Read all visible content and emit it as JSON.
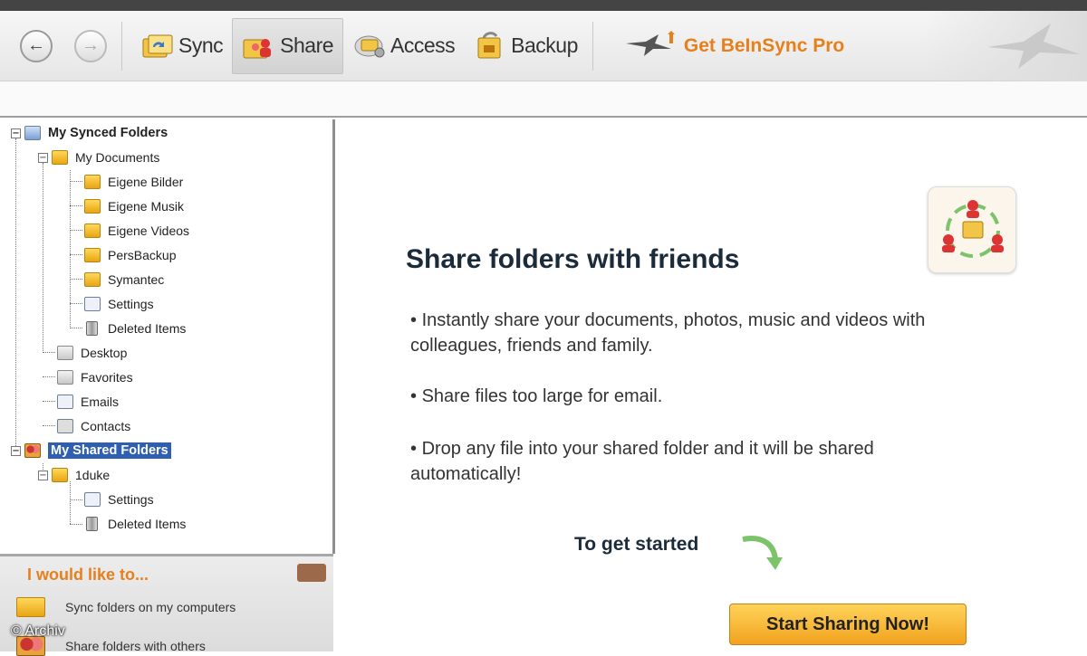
{
  "toolbar": {
    "back_icon": "back-arrow-icon",
    "forward_icon": "forward-arrow-icon",
    "sync_label": "Sync",
    "share_label": "Share",
    "access_label": "Access",
    "backup_label": "Backup",
    "pro_label": "Get BeInSync Pro"
  },
  "tree": {
    "synced_root": "My Synced Folders",
    "my_documents": "My Documents",
    "eigene_bilder": "Eigene Bilder",
    "eigene_musik": "Eigene Musik",
    "eigene_videos": "Eigene Videos",
    "persbackup": "PersBackup",
    "symantec": "Symantec",
    "settings": "Settings",
    "deleted_items": "Deleted Items",
    "desktop": "Desktop",
    "favorites": "Favorites",
    "emails": "Emails",
    "contacts": "Contacts",
    "shared_root": "My Shared Folders",
    "tduke": "1duke",
    "shared_settings": "Settings",
    "shared_deleted": "Deleted Items"
  },
  "would_like": {
    "title": "I would like to...",
    "sync_action": "Sync folders on my computers",
    "share_action": "Share folders with others"
  },
  "main": {
    "heading": "Share folders with friends",
    "bullets": [
      "Instantly share your documents, photos, music and videos with colleagues, friends and family.",
      "Share files too large for email.",
      "Drop any file into your shared folder and it will be shared automatically!"
    ],
    "get_started": "To get started",
    "start_button": "Start Sharing Now!"
  },
  "watermark": "© Archiv",
  "colors": {
    "accent_orange": "#e6801c",
    "selection_blue": "#2f5fb2",
    "button_yellow": "#f2a21e"
  }
}
